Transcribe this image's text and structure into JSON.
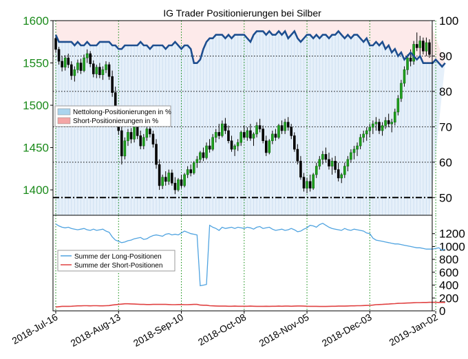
{
  "chart_data": [
    {
      "type": "candlestick+line+area",
      "title": "IG Trader Positionierungen bei Silber",
      "left_axis": {
        "ylim": [
          1370,
          1600
        ],
        "ticks": [
          1400,
          1450,
          1500,
          1550,
          1600
        ],
        "color": "#1a8a1a"
      },
      "right_axis": {
        "ylim": [
          45,
          100
        ],
        "ticks": [
          50,
          60,
          70,
          80,
          90,
          100
        ],
        "color": "#000000"
      },
      "x_ticks": [
        "2018-Jul-16",
        "2018-Aug-13",
        "2018-Sep-10",
        "2018-Oct-08",
        "2018-Nov-05",
        "2018-Dec-03",
        "2019-Jan-02"
      ],
      "x_tick_index": [
        0,
        20,
        40,
        60,
        80,
        100,
        121
      ],
      "dashed_line_right_value": 50,
      "legend": {
        "placement": "left",
        "entries": [
          {
            "label": "Nettolong-Positionierungen in %",
            "color": "#aad4ee"
          },
          {
            "label": "Short-Positionierungen in %",
            "color": "#f4a6a6"
          }
        ]
      },
      "ohlc": [
        [
          1579,
          1582,
          1562,
          1566
        ],
        [
          1566,
          1569,
          1548,
          1552
        ],
        [
          1552,
          1558,
          1540,
          1545
        ],
        [
          1545,
          1559,
          1541,
          1556
        ],
        [
          1556,
          1561,
          1544,
          1548
        ],
        [
          1548,
          1552,
          1530,
          1535
        ],
        [
          1535,
          1546,
          1528,
          1542
        ],
        [
          1542,
          1554,
          1538,
          1550
        ],
        [
          1550,
          1555,
          1537,
          1541
        ],
        [
          1541,
          1560,
          1539,
          1556
        ],
        [
          1556,
          1566,
          1550,
          1561
        ],
        [
          1561,
          1564,
          1545,
          1549
        ],
        [
          1549,
          1553,
          1533,
          1537
        ],
        [
          1537,
          1548,
          1532,
          1545
        ],
        [
          1545,
          1550,
          1532,
          1536
        ],
        [
          1536,
          1546,
          1530,
          1542
        ],
        [
          1542,
          1552,
          1538,
          1548
        ],
        [
          1548,
          1551,
          1530,
          1534
        ],
        [
          1534,
          1541,
          1510,
          1515
        ],
        [
          1515,
          1522,
          1485,
          1490
        ],
        [
          1490,
          1496,
          1465,
          1470
        ],
        [
          1470,
          1478,
          1430,
          1440
        ],
        [
          1440,
          1462,
          1436,
          1458
        ],
        [
          1458,
          1472,
          1452,
          1468
        ],
        [
          1468,
          1473,
          1455,
          1460
        ],
        [
          1460,
          1478,
          1456,
          1474
        ],
        [
          1474,
          1481,
          1460,
          1464
        ],
        [
          1464,
          1470,
          1448,
          1452
        ],
        [
          1452,
          1466,
          1448,
          1462
        ],
        [
          1462,
          1476,
          1458,
          1472
        ],
        [
          1472,
          1478,
          1462,
          1466
        ],
        [
          1466,
          1470,
          1450,
          1454
        ],
        [
          1454,
          1460,
          1425,
          1430
        ],
        [
          1430,
          1436,
          1400,
          1405
        ],
        [
          1405,
          1418,
          1401,
          1415
        ],
        [
          1415,
          1422,
          1405,
          1410
        ],
        [
          1410,
          1424,
          1406,
          1420
        ],
        [
          1420,
          1424,
          1405,
          1408
        ],
        [
          1408,
          1415,
          1395,
          1400
        ],
        [
          1400,
          1414,
          1398,
          1412
        ],
        [
          1412,
          1418,
          1402,
          1405
        ],
        [
          1405,
          1420,
          1403,
          1418
        ],
        [
          1418,
          1428,
          1414,
          1424
        ],
        [
          1424,
          1430,
          1416,
          1420
        ],
        [
          1420,
          1434,
          1418,
          1432
        ],
        [
          1432,
          1440,
          1426,
          1436
        ],
        [
          1436,
          1446,
          1432,
          1444
        ],
        [
          1444,
          1450,
          1434,
          1438
        ],
        [
          1438,
          1456,
          1436,
          1452
        ],
        [
          1452,
          1460,
          1444,
          1448
        ],
        [
          1448,
          1466,
          1446,
          1462
        ],
        [
          1462,
          1472,
          1456,
          1468
        ],
        [
          1468,
          1478,
          1460,
          1464
        ],
        [
          1464,
          1482,
          1462,
          1478
        ],
        [
          1478,
          1485,
          1466,
          1470
        ],
        [
          1470,
          1476,
          1455,
          1458
        ],
        [
          1458,
          1464,
          1445,
          1448
        ],
        [
          1448,
          1454,
          1440,
          1452
        ],
        [
          1452,
          1460,
          1446,
          1456
        ],
        [
          1456,
          1470,
          1452,
          1468
        ],
        [
          1468,
          1476,
          1460,
          1462
        ],
        [
          1462,
          1474,
          1458,
          1470
        ],
        [
          1470,
          1478,
          1458,
          1461
        ],
        [
          1461,
          1468,
          1452,
          1466
        ],
        [
          1466,
          1480,
          1462,
          1476
        ],
        [
          1476,
          1484,
          1468,
          1472
        ],
        [
          1472,
          1476,
          1455,
          1458
        ],
        [
          1458,
          1464,
          1440,
          1444
        ],
        [
          1444,
          1460,
          1442,
          1458
        ],
        [
          1458,
          1470,
          1454,
          1466
        ],
        [
          1466,
          1472,
          1458,
          1462
        ],
        [
          1462,
          1478,
          1460,
          1476
        ],
        [
          1476,
          1482,
          1466,
          1470
        ],
        [
          1470,
          1484,
          1466,
          1480
        ],
        [
          1480,
          1486,
          1470,
          1474
        ],
        [
          1474,
          1478,
          1460,
          1464
        ],
        [
          1464,
          1468,
          1445,
          1448
        ],
        [
          1448,
          1454,
          1430,
          1434
        ],
        [
          1434,
          1440,
          1412,
          1415
        ],
        [
          1415,
          1420,
          1398,
          1402
        ],
        [
          1402,
          1414,
          1396,
          1410
        ],
        [
          1410,
          1418,
          1398,
          1402
        ],
        [
          1402,
          1420,
          1400,
          1418
        ],
        [
          1418,
          1432,
          1414,
          1428
        ],
        [
          1428,
          1440,
          1424,
          1436
        ],
        [
          1436,
          1446,
          1430,
          1442
        ],
        [
          1442,
          1450,
          1432,
          1436
        ],
        [
          1436,
          1444,
          1424,
          1428
        ],
        [
          1428,
          1438,
          1418,
          1434
        ],
        [
          1434,
          1440,
          1420,
          1424
        ],
        [
          1424,
          1432,
          1410,
          1414
        ],
        [
          1414,
          1420,
          1408,
          1418
        ],
        [
          1418,
          1432,
          1414,
          1428
        ],
        [
          1428,
          1440,
          1422,
          1436
        ],
        [
          1436,
          1448,
          1432,
          1444
        ],
        [
          1444,
          1452,
          1436,
          1448
        ],
        [
          1448,
          1456,
          1440,
          1452
        ],
        [
          1452,
          1466,
          1448,
          1462
        ],
        [
          1462,
          1470,
          1456,
          1466
        ],
        [
          1466,
          1474,
          1458,
          1470
        ],
        [
          1470,
          1478,
          1462,
          1474
        ],
        [
          1474,
          1482,
          1466,
          1478
        ],
        [
          1478,
          1486,
          1470,
          1480
        ],
        [
          1480,
          1484,
          1466,
          1470
        ],
        [
          1470,
          1480,
          1464,
          1476
        ],
        [
          1476,
          1486,
          1472,
          1482
        ],
        [
          1482,
          1490,
          1474,
          1478
        ],
        [
          1478,
          1484,
          1468,
          1480
        ],
        [
          1480,
          1496,
          1476,
          1492
        ],
        [
          1492,
          1512,
          1488,
          1508
        ],
        [
          1508,
          1530,
          1504,
          1526
        ],
        [
          1526,
          1546,
          1522,
          1542
        ],
        [
          1542,
          1560,
          1536,
          1556
        ],
        [
          1556,
          1566,
          1546,
          1552
        ],
        [
          1552,
          1576,
          1548,
          1572
        ],
        [
          1572,
          1586,
          1564,
          1568
        ],
        [
          1568,
          1582,
          1558,
          1576
        ],
        [
          1576,
          1580,
          1560,
          1564
        ],
        [
          1564,
          1580,
          1558,
          1574
        ],
        [
          1574,
          1578,
          1556,
          1560
        ]
      ],
      "net_long_pct": [
        96,
        94,
        94,
        94,
        94,
        94,
        93,
        94,
        93,
        93,
        94,
        93,
        93,
        93,
        94,
        94,
        94,
        94,
        93,
        93,
        92,
        92,
        93,
        93,
        93,
        93,
        93,
        94,
        93,
        93,
        92,
        93,
        93,
        93,
        93,
        92,
        93,
        93,
        94,
        93,
        92,
        93,
        93,
        92,
        88,
        88,
        89,
        92,
        94,
        95,
        95,
        96,
        96,
        96,
        95,
        96,
        95,
        96,
        96,
        96,
        96,
        95,
        94,
        96,
        97,
        97,
        97,
        96,
        97,
        96,
        96,
        97,
        96,
        97,
        95,
        96,
        97,
        95,
        94,
        95,
        96,
        96,
        95,
        96,
        95,
        96,
        96,
        95,
        96,
        96,
        97,
        96,
        95,
        96,
        95,
        96,
        96,
        95,
        94,
        95,
        93,
        93,
        94,
        93,
        94,
        92,
        93,
        91,
        92,
        90,
        91,
        89,
        90,
        91,
        90,
        89,
        90,
        88,
        88,
        88,
        88,
        89,
        88,
        87,
        88
      ]
    },
    {
      "type": "line",
      "left_axis": {
        "ticks": []
      },
      "right_axis": {
        "ylim": [
          0,
          1400
        ],
        "ticks": [
          0,
          200,
          400,
          600,
          800,
          1000,
          1200
        ],
        "color": "#000000"
      },
      "x_ticks": [
        "2018-Jul-16",
        "2018-Aug-13",
        "2018-Sep-10",
        "2018-Oct-08",
        "2018-Nov-05",
        "2018-Dec-03",
        "2019-Jan-02"
      ],
      "legend": {
        "placement": "left",
        "entries": [
          {
            "label": "Summe der Long-Positionen",
            "color": "#4fa3e0"
          },
          {
            "label": "Summe der Short-Positionen",
            "color": "#e04040"
          }
        ]
      },
      "series": [
        {
          "name": "Summe der Long-Positionen",
          "color": "#4fa3e0",
          "values": [
            1350,
            1320,
            1300,
            1290,
            1300,
            1280,
            1270,
            1260,
            1270,
            1280,
            1260,
            1250,
            1270,
            1250,
            1260,
            1270,
            1240,
            1220,
            1150,
            1100,
            1080,
            1060,
            1070,
            1090,
            1100,
            1120,
            1130,
            1140,
            1110,
            1120,
            1150,
            1170,
            1180,
            1170,
            1160,
            1190,
            1200,
            1180,
            1190,
            1180,
            1210,
            1240,
            1220,
            1200,
            1190,
            1180,
            390,
            400,
            410,
            1330,
            1300,
            1280,
            1250,
            1300,
            1280,
            1290,
            1300,
            1280,
            1300,
            1290,
            1280,
            1300,
            1290,
            1270,
            1300,
            1310,
            1280,
            1290,
            1300,
            1270,
            1250,
            1260,
            1270,
            1250,
            1260,
            1280,
            1260,
            1230,
            1240,
            1270,
            1290,
            1330,
            1320,
            1300,
            1340,
            1360,
            1330,
            1300,
            1280,
            1270,
            1260,
            1250,
            1280,
            1260,
            1250,
            1270,
            1260,
            1250,
            1240,
            1210,
            1200,
            1130,
            1100,
            1090,
            1080,
            1070,
            1060,
            1050,
            1040,
            1040,
            1030,
            1020,
            1010,
            1000,
            990,
            980,
            980,
            970,
            960,
            960,
            960,
            970,
            980,
            940,
            960
          ]
        },
        {
          "name": "Summe der Short-Positionen",
          "color": "#e04040",
          "values": [
            60,
            65,
            70,
            70,
            70,
            72,
            75,
            78,
            78,
            80,
            80,
            78,
            80,
            80,
            78,
            78,
            80,
            82,
            90,
            95,
            100,
            105,
            110,
            110,
            108,
            106,
            104,
            100,
            100,
            98,
            98,
            100,
            100,
            100,
            102,
            100,
            98,
            96,
            96,
            98,
            98,
            96,
            96,
            98,
            100,
            100,
            90,
            88,
            88,
            80,
            78,
            76,
            74,
            74,
            74,
            72,
            72,
            74,
            72,
            72,
            72,
            72,
            74,
            72,
            70,
            70,
            70,
            72,
            70,
            72,
            72,
            74,
            72,
            74,
            74,
            72,
            74,
            76,
            76,
            74,
            72,
            70,
            70,
            70,
            68,
            68,
            68,
            70,
            72,
            72,
            74,
            74,
            74,
            76,
            78,
            78,
            80,
            80,
            82,
            84,
            86,
            90,
            96,
            98,
            100,
            104,
            106,
            110,
            112,
            116,
            118,
            120,
            122,
            124,
            126,
            128,
            128,
            130,
            130,
            132,
            132,
            132,
            130,
            132,
            130
          ]
        }
      ]
    }
  ]
}
